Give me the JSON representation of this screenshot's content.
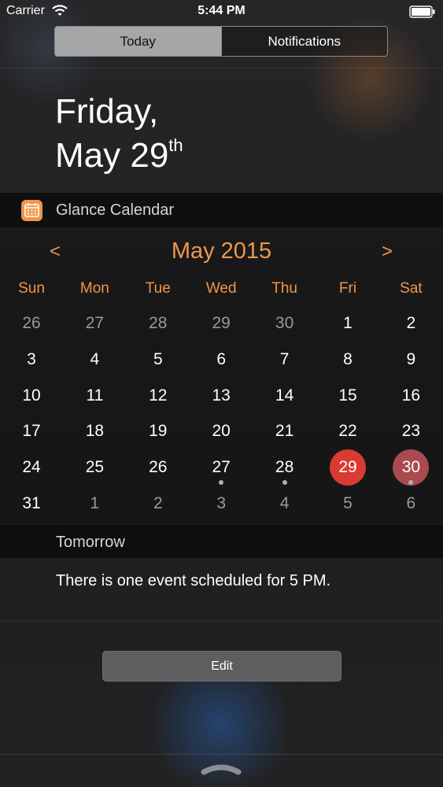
{
  "status_bar": {
    "carrier": "Carrier",
    "time": "5:44 PM"
  },
  "tabs": [
    {
      "label": "Today",
      "active": true
    },
    {
      "label": "Notifications",
      "active": false
    }
  ],
  "date": {
    "line1": "Friday,",
    "line2": "May 29",
    "suffix": "th"
  },
  "widget": {
    "title": "Glance Calendar",
    "icon": "calendar-icon"
  },
  "calendar": {
    "prev_label": "<",
    "next_label": ">",
    "month_title": "May 2015",
    "weekdays": [
      "Sun",
      "Mon",
      "Tue",
      "Wed",
      "Thu",
      "Fri",
      "Sat"
    ],
    "weeks": [
      [
        {
          "n": "26",
          "in": false
        },
        {
          "n": "27",
          "in": false
        },
        {
          "n": "28",
          "in": false
        },
        {
          "n": "29",
          "in": false
        },
        {
          "n": "30",
          "in": false
        },
        {
          "n": "1",
          "in": true
        },
        {
          "n": "2",
          "in": true
        }
      ],
      [
        {
          "n": "3",
          "in": true
        },
        {
          "n": "4",
          "in": true
        },
        {
          "n": "5",
          "in": true
        },
        {
          "n": "6",
          "in": true
        },
        {
          "n": "7",
          "in": true
        },
        {
          "n": "8",
          "in": true
        },
        {
          "n": "9",
          "in": true
        }
      ],
      [
        {
          "n": "10",
          "in": true
        },
        {
          "n": "11",
          "in": true
        },
        {
          "n": "12",
          "in": true
        },
        {
          "n": "13",
          "in": true
        },
        {
          "n": "14",
          "in": true
        },
        {
          "n": "15",
          "in": true
        },
        {
          "n": "16",
          "in": true
        }
      ],
      [
        {
          "n": "17",
          "in": true
        },
        {
          "n": "18",
          "in": true
        },
        {
          "n": "19",
          "in": true
        },
        {
          "n": "20",
          "in": true
        },
        {
          "n": "21",
          "in": true
        },
        {
          "n": "22",
          "in": true
        },
        {
          "n": "23",
          "in": true
        }
      ],
      [
        {
          "n": "24",
          "in": true
        },
        {
          "n": "25",
          "in": true
        },
        {
          "n": "26",
          "in": true
        },
        {
          "n": "27",
          "in": true,
          "event": true
        },
        {
          "n": "28",
          "in": true,
          "event": true
        },
        {
          "n": "29",
          "in": true,
          "today": true
        },
        {
          "n": "30",
          "in": true,
          "selected": true,
          "event": true
        }
      ],
      [
        {
          "n": "31",
          "in": true
        },
        {
          "n": "1",
          "in": false
        },
        {
          "n": "2",
          "in": false
        },
        {
          "n": "3",
          "in": false
        },
        {
          "n": "4",
          "in": false
        },
        {
          "n": "5",
          "in": false
        },
        {
          "n": "6",
          "in": false
        }
      ]
    ],
    "colors": {
      "accent": "#f0964a",
      "today": "#d93a32",
      "selected": "#a84a4f"
    }
  },
  "tomorrow": {
    "label": "Tomorrow",
    "event_text": "There is one event scheduled for 5 PM."
  },
  "edit_label": "Edit"
}
